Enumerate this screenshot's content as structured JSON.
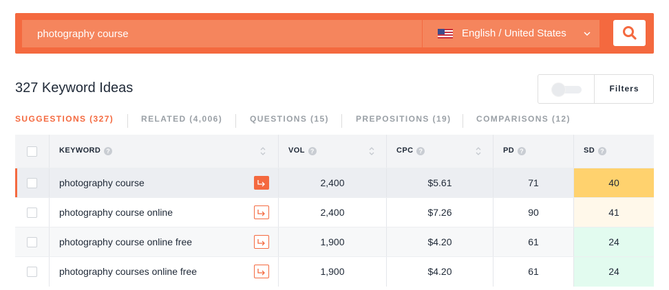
{
  "search": {
    "query": "photography course",
    "locale": "English / United States",
    "locale_flag": "us-flag-icon"
  },
  "header": {
    "title": "327 Keyword Ideas",
    "filters_label": "Filters"
  },
  "tabs": [
    {
      "label": "SUGGESTIONS (327)",
      "active": true
    },
    {
      "label": "RELATED (4,006)",
      "active": false
    },
    {
      "label": "QUESTIONS (15)",
      "active": false
    },
    {
      "label": "PREPOSITIONS (19)",
      "active": false
    },
    {
      "label": "COMPARISONS (12)",
      "active": false
    }
  ],
  "table": {
    "columns": [
      "KEYWORD",
      "VOL",
      "CPC",
      "PD",
      "SD"
    ],
    "rows": [
      {
        "keyword": "photography course",
        "vol": "2,400",
        "cpc": "$5.61",
        "pd": "71",
        "sd": "40",
        "selected": true
      },
      {
        "keyword": "photography course online",
        "vol": "2,400",
        "cpc": "$7.26",
        "pd": "90",
        "sd": "41",
        "selected": false
      },
      {
        "keyword": "photography course online free",
        "vol": "1,900",
        "cpc": "$4.20",
        "pd": "61",
        "sd": "24",
        "selected": false
      },
      {
        "keyword": "photography courses online free",
        "vol": "1,900",
        "cpc": "$4.20",
        "pd": "61",
        "sd": "24",
        "selected": false
      }
    ]
  },
  "colors": {
    "brand": "#f4693f",
    "sd_high": "#ffd26e",
    "sd_mid": "#fff8ea",
    "sd_low": "#e2fbef"
  }
}
